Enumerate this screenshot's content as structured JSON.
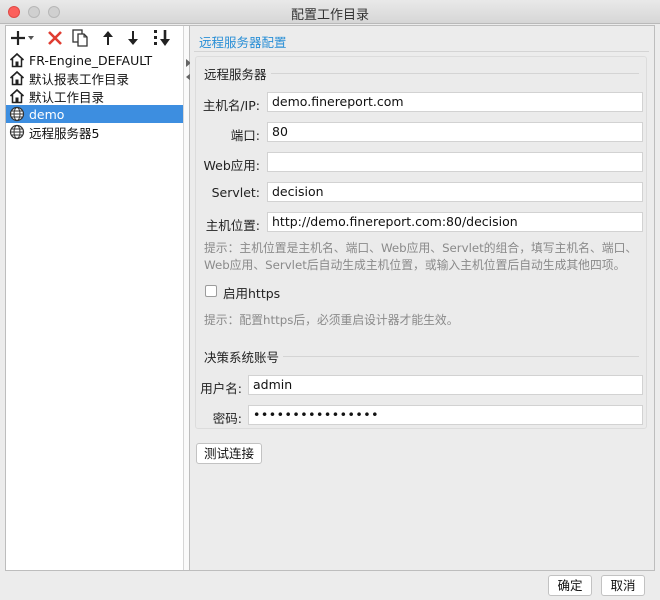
{
  "window": {
    "title": "配置工作目录"
  },
  "toolbar": {
    "add": "plus-icon",
    "delete": "delete-x-icon",
    "copy": "copy-icon",
    "up": "arrow-up-icon",
    "down": "arrow-down-icon",
    "sort": "sort-icon"
  },
  "tree": {
    "items": [
      {
        "label": "FR-Engine_DEFAULT",
        "icon": "house-icon",
        "selected": false
      },
      {
        "label": "默认报表工作目录",
        "icon": "house-icon",
        "selected": false
      },
      {
        "label": "默认工作目录",
        "icon": "house-icon",
        "selected": false
      },
      {
        "label": "demo",
        "icon": "globe-icon",
        "selected": true
      },
      {
        "label": "远程服务器5",
        "icon": "globe-icon",
        "selected": false
      }
    ]
  },
  "config": {
    "section_title": "远程服务器配置",
    "server_group_title": "远程服务器",
    "host_label": "主机名/IP:",
    "host_value": "demo.finereport.com",
    "port_label": "端口:",
    "port_value": "80",
    "webapp_label": "Web应用:",
    "webapp_value": "",
    "servlet_label": "Servlet:",
    "servlet_value": "decision",
    "location_label": "主机位置:",
    "location_value": "http://demo.finereport.com:80/decision",
    "hint1_line1": "提示：主机位置是主机名、端口、Web应用、Servlet的组合，填写主机名、端口、",
    "hint1_line2": "Web应用、Servlet后自动生成主机位置，或输入主机位置后自动生成其他四项。",
    "https_label": "启用https",
    "https_checked": false,
    "hint2": "提示：配置https后，必须重启设计器才能生效。",
    "account_group_title": "决策系统账号",
    "username_label": "用户名:",
    "username_value": "admin",
    "password_label": "密码:",
    "password_value": "••••••••••••••••",
    "test_button": "测试连接"
  },
  "footer": {
    "ok": "确定",
    "cancel": "取消"
  },
  "colors": {
    "accent": "#2a8fd6",
    "selected": "#3d8ee0",
    "delete": "#e03c31"
  }
}
